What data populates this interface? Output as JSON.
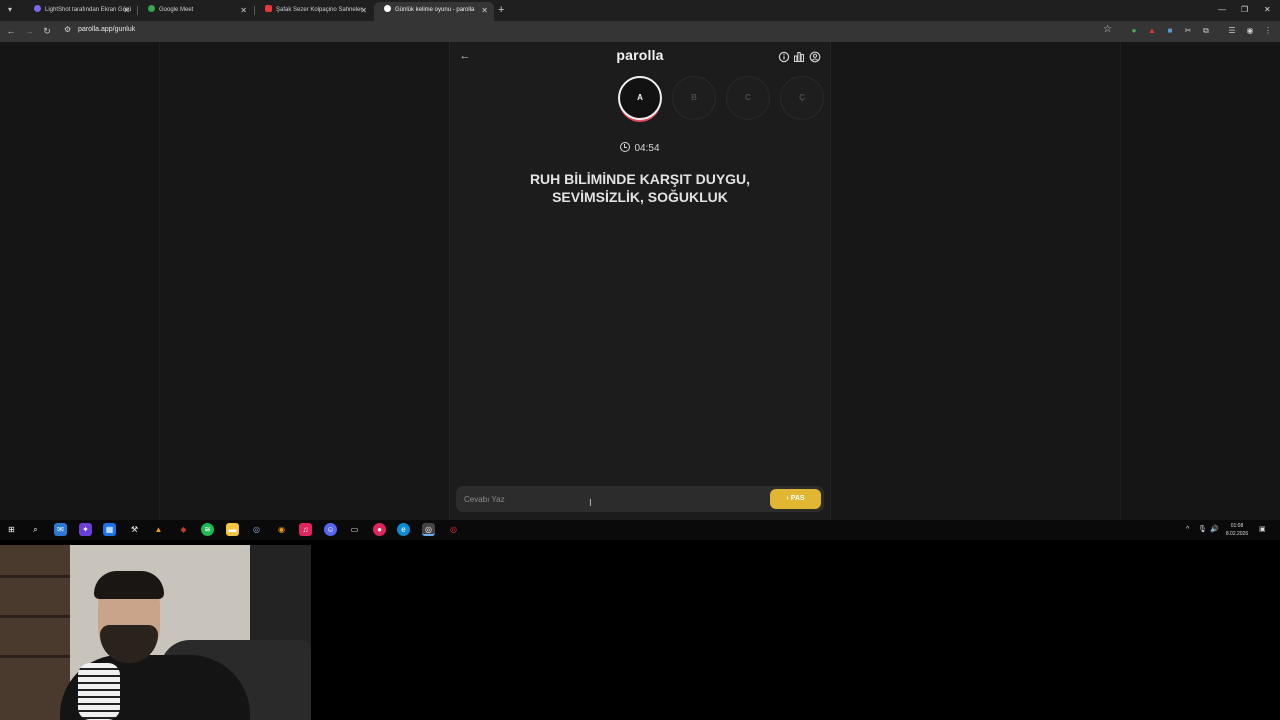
{
  "browser": {
    "tabs": [
      {
        "title": "LightShot tarafından Ekran Görü",
        "favicon_color": "#7b68ee",
        "active": false
      },
      {
        "title": "Google Meet",
        "favicon_color": "#34a853",
        "active": false
      },
      {
        "title": "Şafak Sezer Kolpaçino Sahneler",
        "favicon_color": "#e53935",
        "active": false
      },
      {
        "title": "Günlük kelime oyunu - parolla",
        "favicon_color": "#ffffff",
        "active": true
      }
    ],
    "url": "parolla.app/gunluk"
  },
  "game": {
    "logo": "parolla",
    "letters": [
      {
        "label": "A",
        "current": true
      },
      {
        "label": "B",
        "current": false
      },
      {
        "label": "C",
        "current": false
      },
      {
        "label": "Ç",
        "current": false
      }
    ],
    "timer": "04:54",
    "question_line1": "RUH BİLİMİNDE KARŞIT DUYGU,",
    "question_line2": "SEVİMSİZLİK, SOĞUKLUK",
    "answer_placeholder": "Cevabı Yaz",
    "pass_label": "PAS",
    "accent_color": "#e0b632",
    "current_ring_color": "#e74c5c"
  },
  "taskbar": {
    "time": "01:08",
    "date": "8.02.2026"
  }
}
